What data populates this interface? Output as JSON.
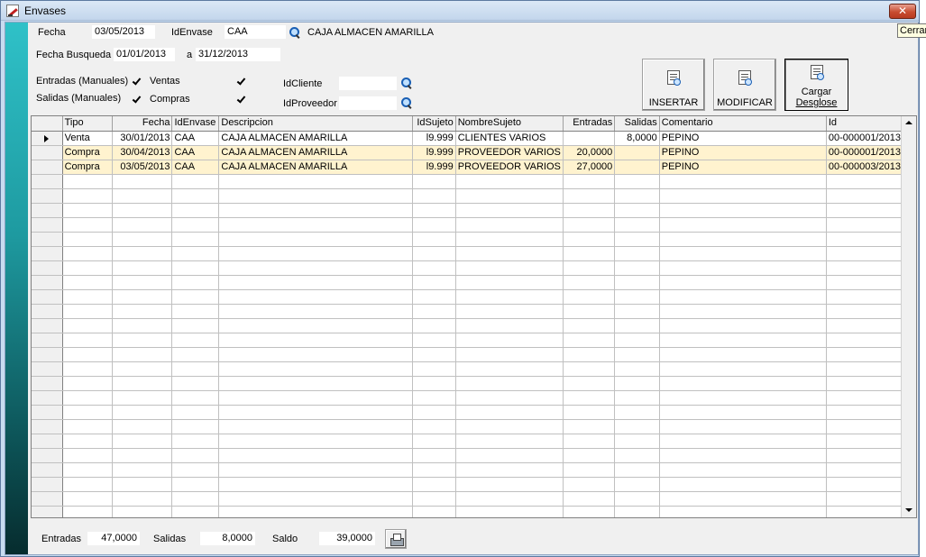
{
  "window": {
    "title": "Envases",
    "close_label": "✕",
    "tooltip": "Cerrar"
  },
  "header": {
    "fecha_label": "Fecha",
    "fecha_value": "03/05/2013",
    "idenvase_label": "IdEnvase",
    "idenvase_value": "CAA",
    "envase_desc": "CAJA ALMACEN AMARILLA",
    "busqueda_label": "Fecha Busqueda",
    "busqueda_from": "01/01/2013",
    "busqueda_sep": "a",
    "busqueda_to": "31/12/2013"
  },
  "filters": {
    "entradas_manuales": "Entradas (Manuales)",
    "salidas_manuales": "Salidas (Manuales)",
    "ventas": "Ventas",
    "compras": "Compras",
    "idcliente_label": "IdCliente",
    "idcliente_value": "",
    "idproveedor_label": "IdProveedor",
    "idproveedor_value": ""
  },
  "toolbar": {
    "insertar": "INSERTAR",
    "modificar": "MODIFICAR",
    "cargar_line1": "Cargar",
    "cargar_line2": "Desglose"
  },
  "grid": {
    "columns": [
      "Tipo",
      "Fecha",
      "IdEnvase",
      "Descripcion",
      "IdSujeto",
      "NombreSujeto",
      "Entradas",
      "Salidas",
      "Comentario",
      "Id"
    ],
    "rows": [
      [
        "Venta",
        "30/01/2013",
        "CAA",
        "CAJA ALMACEN AMARILLA",
        "l9.999",
        "CLIENTES VARIOS",
        "",
        "8,0000",
        "PEPINO",
        "00-000001/2013"
      ],
      [
        "Compra",
        "30/04/2013",
        "CAA",
        "CAJA ALMACEN AMARILLA",
        "l9.999",
        "PROVEEDOR VARIOS",
        "20,0000",
        "",
        "PEPINO",
        "00-000001/2013"
      ],
      [
        "Compra",
        "03/05/2013",
        "CAA",
        "CAJA ALMACEN AMARILLA",
        "l9.999",
        "PROVEEDOR VARIOS",
        "27,0000",
        "",
        "PEPINO",
        "00-000003/2013"
      ]
    ]
  },
  "footer": {
    "entradas_label": "Entradas",
    "entradas_value": "47,0000",
    "salidas_label": "Salidas",
    "salidas_value": "8,0000",
    "saldo_label": "Saldo",
    "saldo_value": "39,0000"
  },
  "colors": {
    "side_gradient_top": "#2fc1c8",
    "side_gradient_bottom": "#062c2e",
    "alt_row": "#fff3cf"
  }
}
